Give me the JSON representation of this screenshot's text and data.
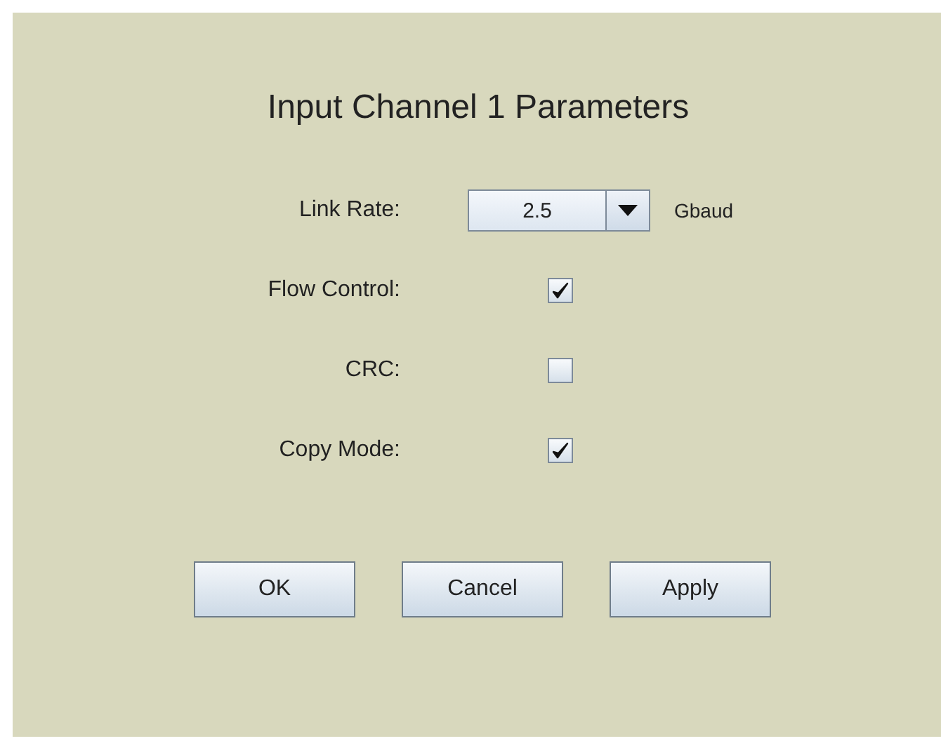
{
  "title": "Input Channel 1 Parameters",
  "fields": [
    {
      "kind": "combo",
      "label": "Link Rate:",
      "value": "2.5",
      "unit": "Gbaud"
    },
    {
      "kind": "checkbox",
      "label": "Flow Control:",
      "checked": true
    },
    {
      "kind": "checkbox",
      "label": "CRC:",
      "checked": false
    },
    {
      "kind": "checkbox",
      "label": "Copy Mode:",
      "checked": true
    }
  ],
  "buttons": [
    "OK",
    "Cancel",
    "Apply"
  ]
}
